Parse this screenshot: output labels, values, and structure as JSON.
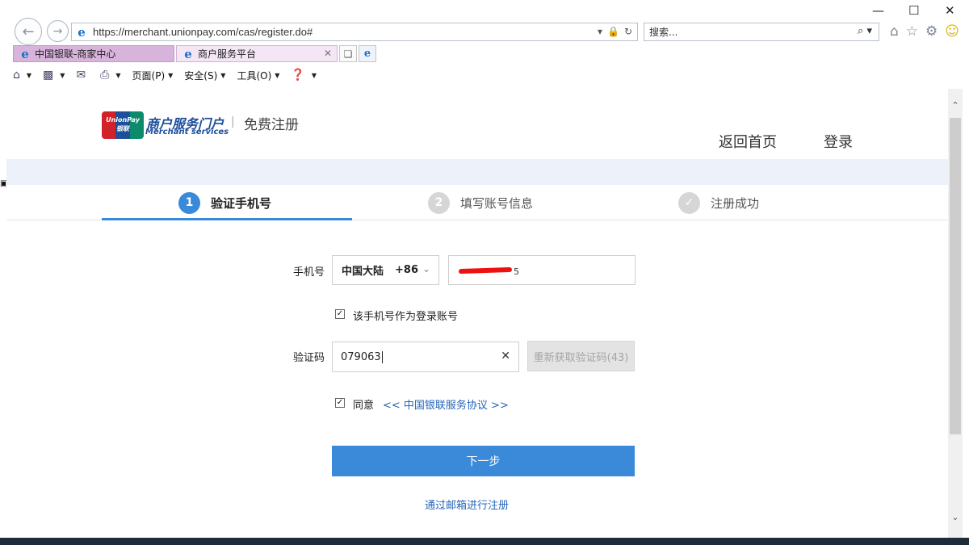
{
  "browser": {
    "url": "https://merchant.unionpay.com/cas/register.do#",
    "search_placeholder": "搜索...",
    "tabs": [
      {
        "label": "中国银联-商家中心"
      },
      {
        "label": "商户服务平台"
      }
    ],
    "commands": {
      "page": "页面(P)",
      "safety": "安全(S)",
      "tools": "工具(O)"
    }
  },
  "header": {
    "logo_text": "UnionPay 银联",
    "brand_cn": "商户服务门户",
    "brand_en": "Merchant services",
    "separator": "|",
    "register_title": "免费注册",
    "home_link": "返回首页",
    "login_link": "登录"
  },
  "steps": [
    {
      "num": "1",
      "label": "验证手机号"
    },
    {
      "num": "2",
      "label": "填写账号信息"
    },
    {
      "num": "✓",
      "label": "注册成功"
    }
  ],
  "form": {
    "phone_label": "手机号",
    "country": "中国大陆",
    "country_code": "+86",
    "phone_tail": "5",
    "use_as_login_label": "该手机号作为登录账号",
    "code_label": "验证码",
    "code_value": "079063",
    "resend_label": "重新获取验证码(43)",
    "agree_label": "同意",
    "agreement_link": "<< 中国银联服务协议 >>",
    "next_button": "下一步",
    "email_register_link": "通过邮箱进行注册"
  },
  "colors": {
    "accent": "#3b8ad9",
    "link": "#2766b6",
    "band": "#edf1f9"
  }
}
